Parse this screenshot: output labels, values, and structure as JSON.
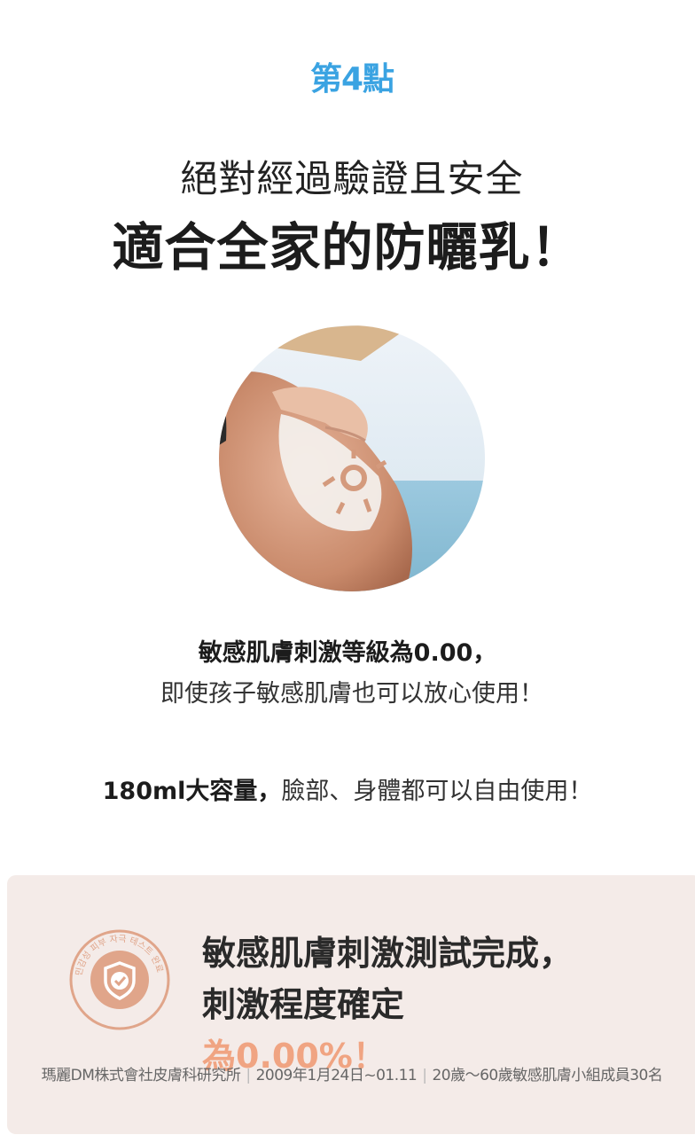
{
  "header": {
    "point_label": "第4點",
    "subheadline": "絕對經過驗證且安全",
    "headline": "適合全家的防曬乳！"
  },
  "image": {
    "alt": "hand applying sunscreen on shoulder"
  },
  "description": {
    "bold_line": "敏感肌膚刺激等級為0.00，",
    "normal_line": "即使孩子敏感肌膚也可以放心使用！",
    "capacity_bold": "180ml大容量，",
    "capacity_rest": "臉部、身體都可以自由使用！"
  },
  "test_panel": {
    "badge_text": "민감성 피부 자극 테스트 완료",
    "title_line1": "敏感肌膚刺激測試完成，",
    "title_line2": "刺激程度確定",
    "title_highlight": "為0.00%！",
    "footnote_org": "瑪麗DM株式會社皮膚科研究所",
    "footnote_date": "2009年1月24日~01.11",
    "footnote_group": "20歲～60歲敏感肌膚小組成員30名"
  },
  "colors": {
    "accent_blue": "#3aa3e2",
    "panel_bg": "#f4ebe8",
    "highlight_peach": "#f0a482",
    "badge_brown": "#e0a58a"
  }
}
